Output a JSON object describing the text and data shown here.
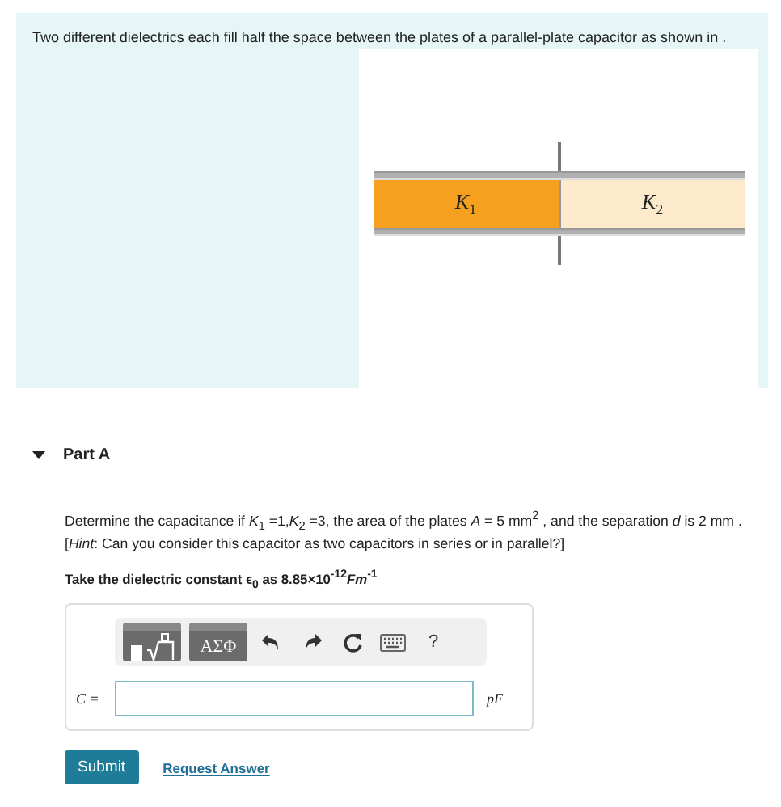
{
  "problem": {
    "text": "Two different dielectrics each fill half the space between the plates of a parallel-plate capacitor as shown in .",
    "figure": {
      "dielectrics": [
        {
          "label": "*K*$_{1}$",
          "color": "#f5a01e"
        },
        {
          "label": "*K*$_{2}$",
          "color": "#fde9cc"
        }
      ]
    }
  },
  "part": {
    "title": "Part A",
    "expanded": true,
    "question": "Determine  the capacitance if *K*$_{1}$ =1,*K*$_{2}$ =3, the area of the plates  *A* = 5 mm$^{2}$ , and the separation  *d* is 2 mm  . [*Hint*: Can you consider this capacitor as two capacitors in series or in parallel?]",
    "note": "Take the dielectric constant ϵ$_{0}$  as 8.85×10$^{-12}$*Fm*$^{-1}$",
    "toolbar": [
      {
        "kind": "templates"
      },
      {
        "kind": "symbols",
        "label": "ΑΣΦ"
      },
      {
        "kind": "undo"
      },
      {
        "kind": "redo"
      },
      {
        "kind": "reset"
      },
      {
        "kind": "keyboard"
      },
      {
        "kind": "help",
        "label": "?"
      }
    ],
    "answer": {
      "prefix": "C =",
      "unit": "pF"
    },
    "buttons": [
      {
        "kind": "primary",
        "label": "Submit"
      },
      {
        "kind": "link",
        "label": "Request Answer"
      }
    ]
  }
}
